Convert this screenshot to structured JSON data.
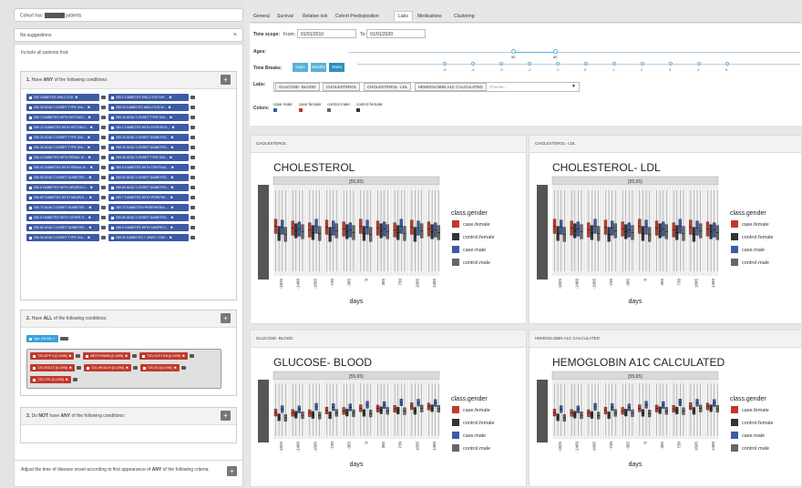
{
  "cohort": {
    "prefix": "Cohort has",
    "suffix": "patients"
  },
  "suggestions": {
    "text": "No suggestions",
    "clear": "×"
  },
  "include_label": "Include all patients that:",
  "block1": {
    "num": "1.",
    "pre": "Have",
    "bold": "ANY",
    "post": "of the following conditions:",
    "plus": "+"
  },
  "block1_tags": [
    "250 DIABETES MELLITUS",
    "250.0 DIABETES MELLITUS WIT...",
    "250.00 ADULT-ONSET TYPE DIA...",
    "250.02 DIABETES MELLITUS W...",
    "250.1 DIABETES WITH KETOACI...",
    "250.10 ADULT-ONSET TYPE DIA...",
    "250.12 DIABETES WITH KETOACI...",
    "250.2 DIABETES WITH HYPEROS...",
    "250.20 ADULT-ONSET TYPE DIA...",
    "250.22 ADULT-ONSET DIABETES...",
    "250.30 ADULT-ONSET TYPE DIA...",
    "250.32 ADULT-ONSET DIABETES...",
    "250.4 DIABETES WITH RENAL M...",
    "250.40 ADULT-ONSET TYPE DIA...",
    "250.42 DIABETES WITH RENAL M...",
    "250.5 DIABETES WITH OPHTHAL...",
    "250.50 ADULT-ONSET DIABETES...",
    "250.52 ADULT-ONSET DIABETES...",
    "250.6 DIABETES WITH NEUROLO...",
    "250.60 ADULT-ONSET DIABETES...",
    "250.62 DIABETES WITH NEUROL...",
    "250.7 DIABETES WITH PERIPHE...",
    "250.70 ADULT-ONSET DIABETES...",
    "250.72 DIABETES+PERIPHERAL ...",
    "250.8 DIABETES WITH OTHER S...",
    "250.80 ADULT-ONSET DIABETES...",
    "250.82 ADULT-ONSET DIABETES...",
    "250.9 DIABETES WITH UNSPECI...",
    "250.90 ADULT-ONSET TYPE DIA...",
    "250.92 DIABETES + UNSP. COM..."
  ],
  "block2": {
    "num": "2.",
    "pre": "Have",
    "bold": "ALL",
    "post": "of the following conditions:",
    "plus": "+"
  },
  "block2_age": "Age: [55,65) ✓",
  "block2_tags": [
    "T2D,DPP-4 [0,1095]",
    "METFORMIN [0,1095]",
    "T2D,GLP1 RA [0,1095]",
    "T2D,SGLT2 [0,1095]",
    "T2D,INSULIN [0,1095]",
    "T2D,SU [0,1095]",
    "T2D,TZD [0,1095]"
  ],
  "block3": {
    "num": "3.",
    "pre": "Do",
    "bold": "NOT",
    "mid": "have",
    "bold2": "ANY",
    "post": "of the following conditions:",
    "plus": "+"
  },
  "adjust": {
    "pre": "Adjust the time of disease onset according to first appearance of",
    "bold": "ANY",
    "post": "of the following criteria:",
    "plus": "+"
  },
  "tabs": [
    "General",
    "Survival",
    "Relative risk",
    "Cohort Predisposition",
    "Labs",
    "Medications",
    "Clustering"
  ],
  "active_tab": "Labs",
  "time_scope": {
    "label": "Time scope:",
    "from_label": "From:",
    "from": "01/01/2010",
    "to_label": "To:",
    "to": "01/01/2020"
  },
  "ages": {
    "label": "Ages:",
    "min": "55",
    "max": "65"
  },
  "time_breaks": {
    "label": "Time Breaks:",
    "options": [
      "Days",
      "Months",
      "Years"
    ],
    "ticks": [
      "-5",
      "-4",
      "-3",
      "-2",
      "-1",
      "0",
      "1",
      "2",
      "3",
      "4",
      "5"
    ]
  },
  "labs": {
    "label": "Labs:",
    "selected": [
      "GLUCOSE- BLOOD",
      "CHOLESTEROL",
      "CHOLESTEROL- LDL",
      "HEMOGLOBIN A1C CALCULATED"
    ],
    "placeholder": "Choose..."
  },
  "colors": {
    "label": "Colors:",
    "items": [
      {
        "name": "case male:",
        "color": "#3c5aa6"
      },
      {
        "name": "case female:",
        "color": "#c0392b"
      },
      {
        "name": "control male:",
        "color": "#666666"
      },
      {
        "name": "control female:",
        "color": "#333333"
      }
    ]
  },
  "panels": [
    {
      "header": "CHOLESTEROL",
      "title": "CHOLESTEROL"
    },
    {
      "header": "CHOLESTEROL- LDL",
      "title": "CHOLESTEROL- LDL"
    },
    {
      "header": "GLUCOSE- BLOOD",
      "title": "GLUCOSE- BLOOD"
    },
    {
      "header": "HEMOGLOBIN A1C CALCULATED",
      "title": "HEMOGLOBIN A1C CALCULATED"
    }
  ],
  "plot_common": {
    "strip": "[55,65)",
    "xlabel": "days",
    "ticks": [
      "-1825",
      "-1460",
      "-1095",
      "-730",
      "-365",
      "0",
      "365",
      "730",
      "1095",
      "1460"
    ],
    "legend_title": "class.gender",
    "legend": [
      "case.female",
      "control.female",
      "case.male",
      "control.male"
    ],
    "legend_colors": [
      "#c0392b",
      "#333333",
      "#3c5aa6",
      "#666666"
    ]
  }
}
